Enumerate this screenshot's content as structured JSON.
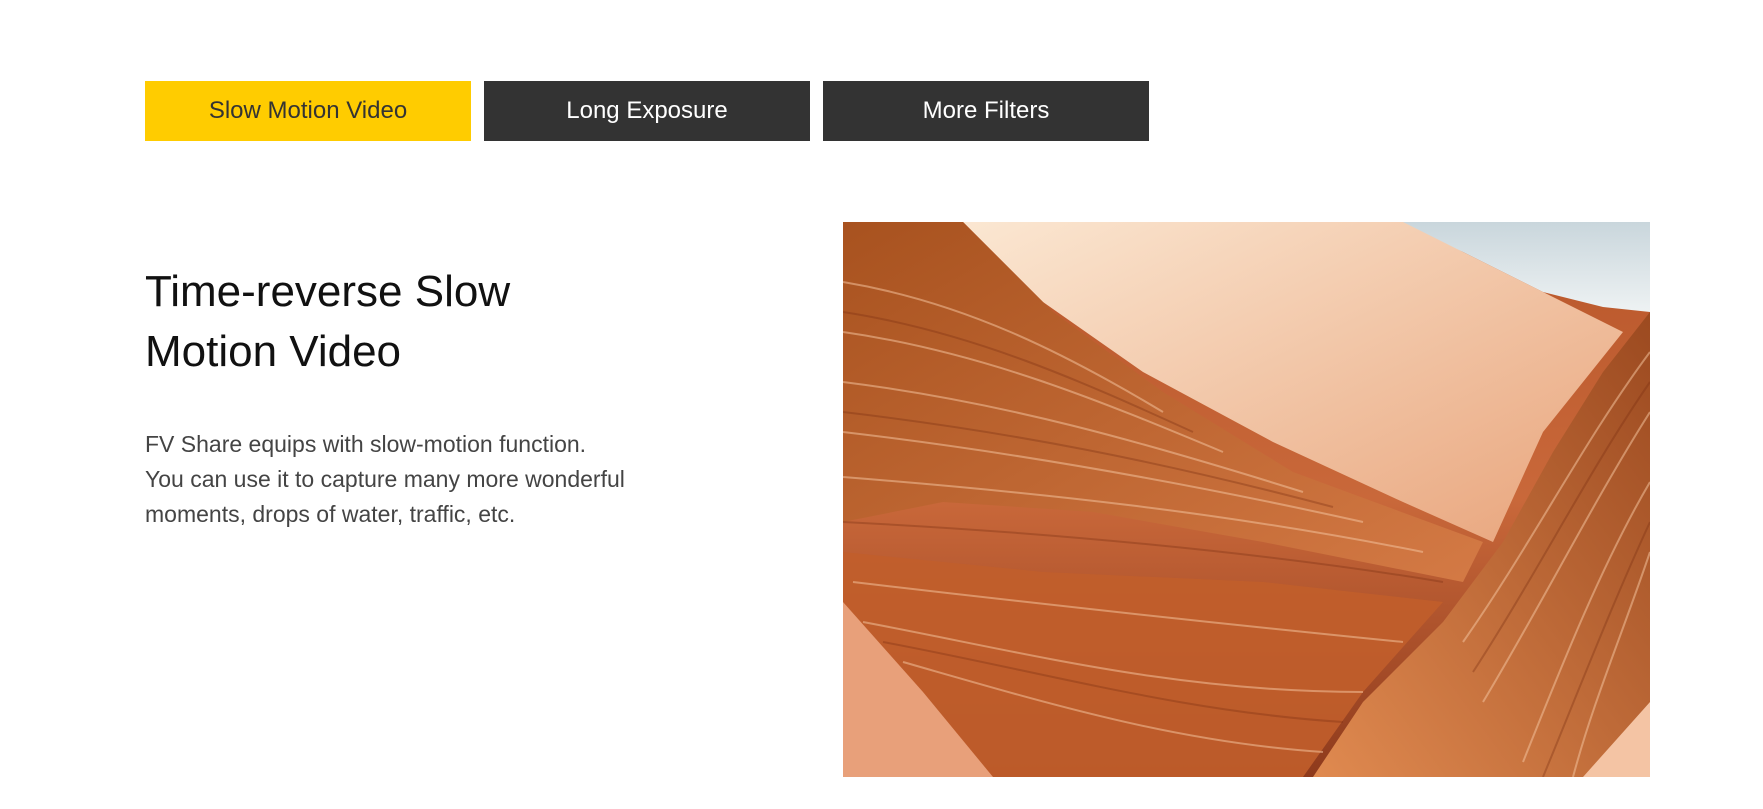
{
  "tabs": [
    {
      "label": "Slow Motion Video",
      "active": true
    },
    {
      "label": "Long Exposure",
      "active": false
    },
    {
      "label": "More Filters",
      "active": false
    }
  ],
  "feature": {
    "title_lines": [
      "Time-reverse Slow",
      "Motion Video"
    ],
    "description_lines": [
      "FV Share equips with slow-motion function.",
      "You can use it to capture many more wonderful",
      "moments, drops of water, traffic, etc."
    ],
    "image_subject": "sandstone-canyon-photo"
  },
  "colors": {
    "accent": "#ffcc00",
    "tab_dark": "#333333",
    "text_dark": "#111111",
    "text_body": "#444444"
  }
}
